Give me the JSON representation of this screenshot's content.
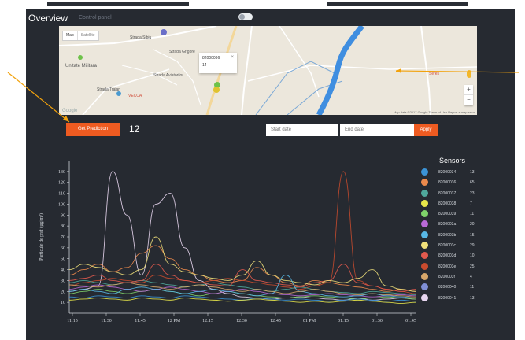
{
  "header": {
    "title": "Overview",
    "subtitle": "Control panel"
  },
  "map": {
    "tabs": [
      "Map",
      "Satellite"
    ],
    "popup": {
      "sensor_id": "82000036",
      "value": "14"
    },
    "labels": {
      "unitate": "Unitate Militara",
      "vecca": "VECCA",
      "street1": "Strada Sibiu",
      "street2": "Strada Traian",
      "street3": "Strada Aviatorilor",
      "street4": "Strada Grigore",
      "town": "Seres"
    },
    "attribution": "Map data ©2017 Google   Terms of Use   Report a map error",
    "google": "Google",
    "zoom_in": "+",
    "zoom_out": "−"
  },
  "controls": {
    "predict_label": "Get Prediction",
    "prediction_value": "12",
    "start_placeholder": "Start date",
    "end_placeholder": "End date",
    "apply_label": "Apply"
  },
  "legend": {
    "title": "Sensors",
    "items": [
      {
        "id": "82000034",
        "count": "13",
        "color": "#3b93d6"
      },
      {
        "id": "82000036",
        "count": "65",
        "color": "#ec8a4c"
      },
      {
        "id": "82000037",
        "count": "23",
        "color": "#4fa89c"
      },
      {
        "id": "82000038",
        "count": "7",
        "color": "#e7e64a"
      },
      {
        "id": "82000039",
        "count": "11",
        "color": "#7fd36a"
      },
      {
        "id": "8200003a",
        "count": "20",
        "color": "#b96ad8"
      },
      {
        "id": "8200003b",
        "count": "15",
        "color": "#58b8e6"
      },
      {
        "id": "8200003c",
        "count": "29",
        "color": "#f0e07a"
      },
      {
        "id": "8200003d",
        "count": "10",
        "color": "#e25a4e"
      },
      {
        "id": "8200003e",
        "count": "25",
        "color": "#c94b2e"
      },
      {
        "id": "8200003f",
        "count": "4",
        "color": "#d7a76a"
      },
      {
        "id": "82000040",
        "count": "11",
        "color": "#7f8fd6"
      },
      {
        "id": "82000041",
        "count": "13",
        "color": "#e8d6f0"
      }
    ]
  },
  "chart_data": {
    "type": "line",
    "ylabel": "Particule de praf (µg/m³)",
    "ylim": [
      0,
      140
    ],
    "yticks": [
      10,
      20,
      30,
      40,
      50,
      60,
      70,
      80,
      90,
      100,
      110,
      120,
      130
    ],
    "xticks": [
      "11:15",
      "11:30",
      "11:45",
      "12 PM",
      "12:15",
      "12:30",
      "12:45",
      "01 PM",
      "01:15",
      "01:30",
      "01:45"
    ],
    "grid": false,
    "legend_position": "right",
    "series": [
      {
        "color": "#e8d6f0",
        "values": [
          20,
          22,
          25,
          130,
          90,
          35,
          100,
          110,
          60,
          30,
          22,
          18,
          15,
          14,
          13,
          14,
          15,
          14,
          13,
          12,
          14,
          12,
          13,
          14,
          13
        ]
      },
      {
        "color": "#ec8a4c",
        "values": [
          35,
          40,
          45,
          38,
          42,
          55,
          62,
          50,
          40,
          35,
          30,
          28,
          30,
          42,
          35,
          28,
          25,
          30,
          28,
          26,
          24,
          22,
          20,
          22,
          20
        ]
      },
      {
        "color": "#c94b2e",
        "values": [
          25,
          28,
          30,
          32,
          30,
          28,
          35,
          32,
          30,
          28,
          30,
          32,
          30,
          28,
          26,
          24,
          22,
          25,
          28,
          130,
          30,
          25,
          22,
          20,
          18
        ]
      },
      {
        "color": "#7fd36a",
        "values": [
          18,
          20,
          22,
          20,
          18,
          20,
          22,
          20,
          18,
          16,
          18,
          20,
          18,
          16,
          15,
          14,
          15,
          16,
          15,
          14,
          13,
          14,
          15,
          14,
          13
        ]
      },
      {
        "color": "#3b93d6",
        "values": [
          15,
          14,
          16,
          15,
          14,
          16,
          15,
          14,
          16,
          15,
          14,
          13,
          12,
          14,
          13,
          12,
          13,
          12,
          11,
          12,
          13,
          12,
          11,
          12,
          11
        ]
      },
      {
        "color": "#e7e64a",
        "values": [
          12,
          13,
          14,
          13,
          12,
          14,
          13,
          12,
          14,
          13,
          12,
          11,
          12,
          13,
          12,
          11,
          10,
          11,
          10,
          11,
          12,
          11,
          10,
          9,
          10
        ]
      },
      {
        "color": "#b96ad8",
        "values": [
          22,
          24,
          26,
          24,
          22,
          20,
          22,
          24,
          22,
          20,
          18,
          20,
          22,
          20,
          18,
          17,
          16,
          17,
          18,
          17,
          16,
          15,
          16,
          17,
          16
        ]
      },
      {
        "color": "#4fa89c",
        "values": [
          28,
          30,
          28,
          26,
          28,
          30,
          28,
          26,
          24,
          26,
          28,
          26,
          24,
          22,
          20,
          22,
          24,
          22,
          20,
          19,
          18,
          20,
          19,
          18,
          17
        ]
      },
      {
        "color": "#e25a4e",
        "values": [
          30,
          32,
          35,
          30,
          28,
          30,
          45,
          35,
          30,
          28,
          26,
          25,
          40,
          30,
          28,
          26,
          24,
          28,
          30,
          45,
          28,
          25,
          22,
          20,
          22
        ]
      },
      {
        "color": "#f0e07a",
        "values": [
          40,
          45,
          42,
          38,
          35,
          40,
          70,
          45,
          38,
          35,
          32,
          30,
          35,
          48,
          35,
          30,
          28,
          26,
          30,
          28,
          32,
          40,
          25,
          22,
          20
        ]
      },
      {
        "color": "#58b8e6",
        "values": [
          20,
          22,
          20,
          18,
          22,
          24,
          22,
          20,
          18,
          20,
          22,
          20,
          18,
          16,
          18,
          35,
          20,
          18,
          16,
          15,
          16,
          18,
          16,
          15,
          14
        ]
      },
      {
        "color": "#d7a76a",
        "values": [
          26,
          25,
          24,
          26,
          28,
          26,
          24,
          22,
          24,
          26,
          24,
          22,
          20,
          22,
          20,
          18,
          20,
          22,
          20,
          18,
          17,
          18,
          17,
          16,
          15
        ]
      }
    ]
  }
}
